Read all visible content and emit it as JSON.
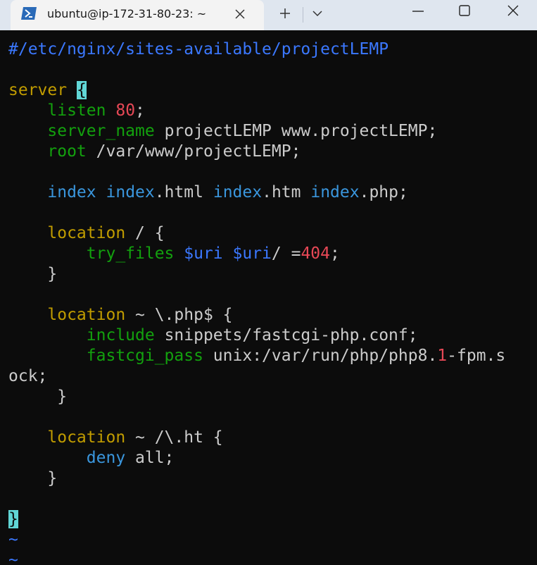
{
  "tab": {
    "title": "ubuntu@ip-172-31-80-23: ~",
    "icon": "powershell-icon"
  },
  "controls": {
    "new_tab_icon": "plus-icon",
    "dropdown_icon": "chevron-down-icon",
    "minimize_icon": "minimize-icon",
    "maximize_icon": "maximize-icon",
    "close_icon": "close-icon"
  },
  "colors": {
    "background": "#0c0c0c",
    "comment": "#3b78ff",
    "keyword": "#c19c00",
    "directive": "#13a10e",
    "builtin": "#3a96dd",
    "number": "#e74856",
    "cursor": "#61d6d6"
  },
  "editor": {
    "line1": {
      "comment": "#/etc/nginx/sites-available/projectLEMP"
    },
    "line3": {
      "kw": "server",
      "brace": "{"
    },
    "line4": {
      "indent": "    ",
      "kw": "listen",
      "num": "80",
      "semi": ";"
    },
    "line5": {
      "indent": "    ",
      "kw": "server_name",
      "rest": " projectLEMP www.projectLEMP;"
    },
    "line6": {
      "indent": "    ",
      "kw": "root",
      "rest": " /var/www/projectLEMP;"
    },
    "line8": {
      "indent": "    ",
      "kw1": "index",
      "sp1": " ",
      "kw2": "index",
      "t2": ".html ",
      "kw3": "index",
      "t3": ".htm ",
      "kw4": "index",
      "t4": ".php;"
    },
    "line10": {
      "indent": "    ",
      "kw": "location",
      "rest": " / {"
    },
    "line11": {
      "indent": "        ",
      "kw": "try_files",
      "sp1": " ",
      "var1": "$uri",
      "sp2": " ",
      "var2": "$uri",
      "t1": "/ =",
      "num": "404",
      "semi": ";"
    },
    "line12": {
      "text": "    }"
    },
    "line14": {
      "indent": "    ",
      "kw": "location",
      "rest": " ~ \\.php$ {"
    },
    "line15": {
      "indent": "        ",
      "kw": "include",
      "rest": " snippets/fastcgi-php.conf;"
    },
    "line16": {
      "indent": "        ",
      "kw": "fastcgi_pass",
      "t1": " unix:/var/run/php/php8.",
      "num": "1",
      "t2": "-fpm.s"
    },
    "line17": {
      "text": "ock;"
    },
    "line18": {
      "text": "     }"
    },
    "line20": {
      "indent": "    ",
      "kw": "location",
      "rest": " ~ /\\.ht {"
    },
    "line21": {
      "indent": "        ",
      "kw": "deny",
      "rest": " all;"
    },
    "line22": {
      "text": "    }"
    },
    "line24": {
      "brace": "}"
    },
    "tilde": "~"
  }
}
